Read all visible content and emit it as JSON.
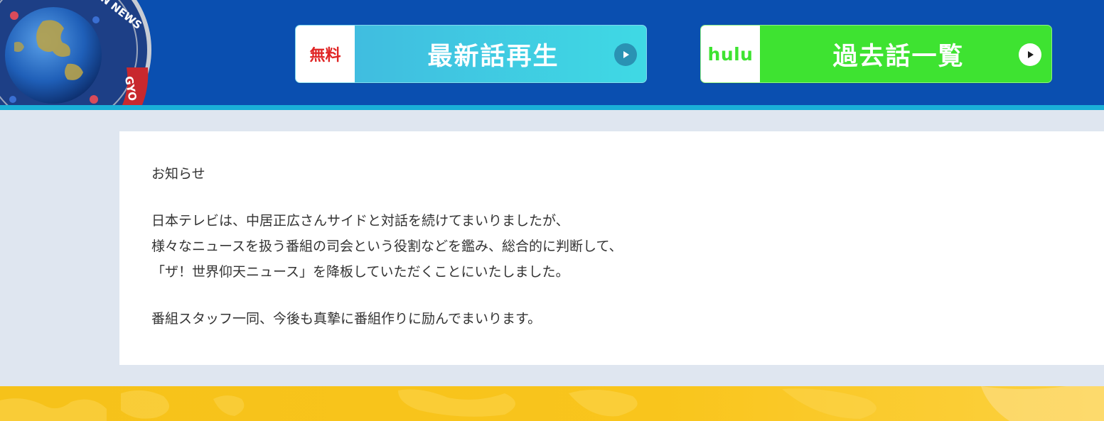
{
  "header": {
    "logo_text": "THE WORLD GYOTEN NEWS",
    "free_button": {
      "tag": "無料",
      "label": "最新話再生",
      "icon": "play-icon"
    },
    "hulu_button": {
      "tag": "hulu",
      "label": "過去話一覧",
      "icon": "play-icon"
    }
  },
  "notice": {
    "heading": "お知らせ",
    "lines": [
      "日本テレビは、中居正広さんサイドと対話を続けてまいりましたが、",
      "様々なニュースを扱う番組の司会という役割などを鑑み、総合的に判断して、",
      "「ザ！世界仰天ニュース」を降板していただくことにいたしました。",
      "番組スタッフ一同、今後も真摯に番組作りに励んでまいります。"
    ]
  },
  "colors": {
    "header_bg": "#0a4fb0",
    "header_stripe": "#1ab0d8",
    "page_bg": "#dfe6f0",
    "free_button_bg": "#40b7df",
    "hulu_green": "#3ee331",
    "free_tag_red": "#e02525",
    "footer_yellow": "#f9c51c"
  }
}
